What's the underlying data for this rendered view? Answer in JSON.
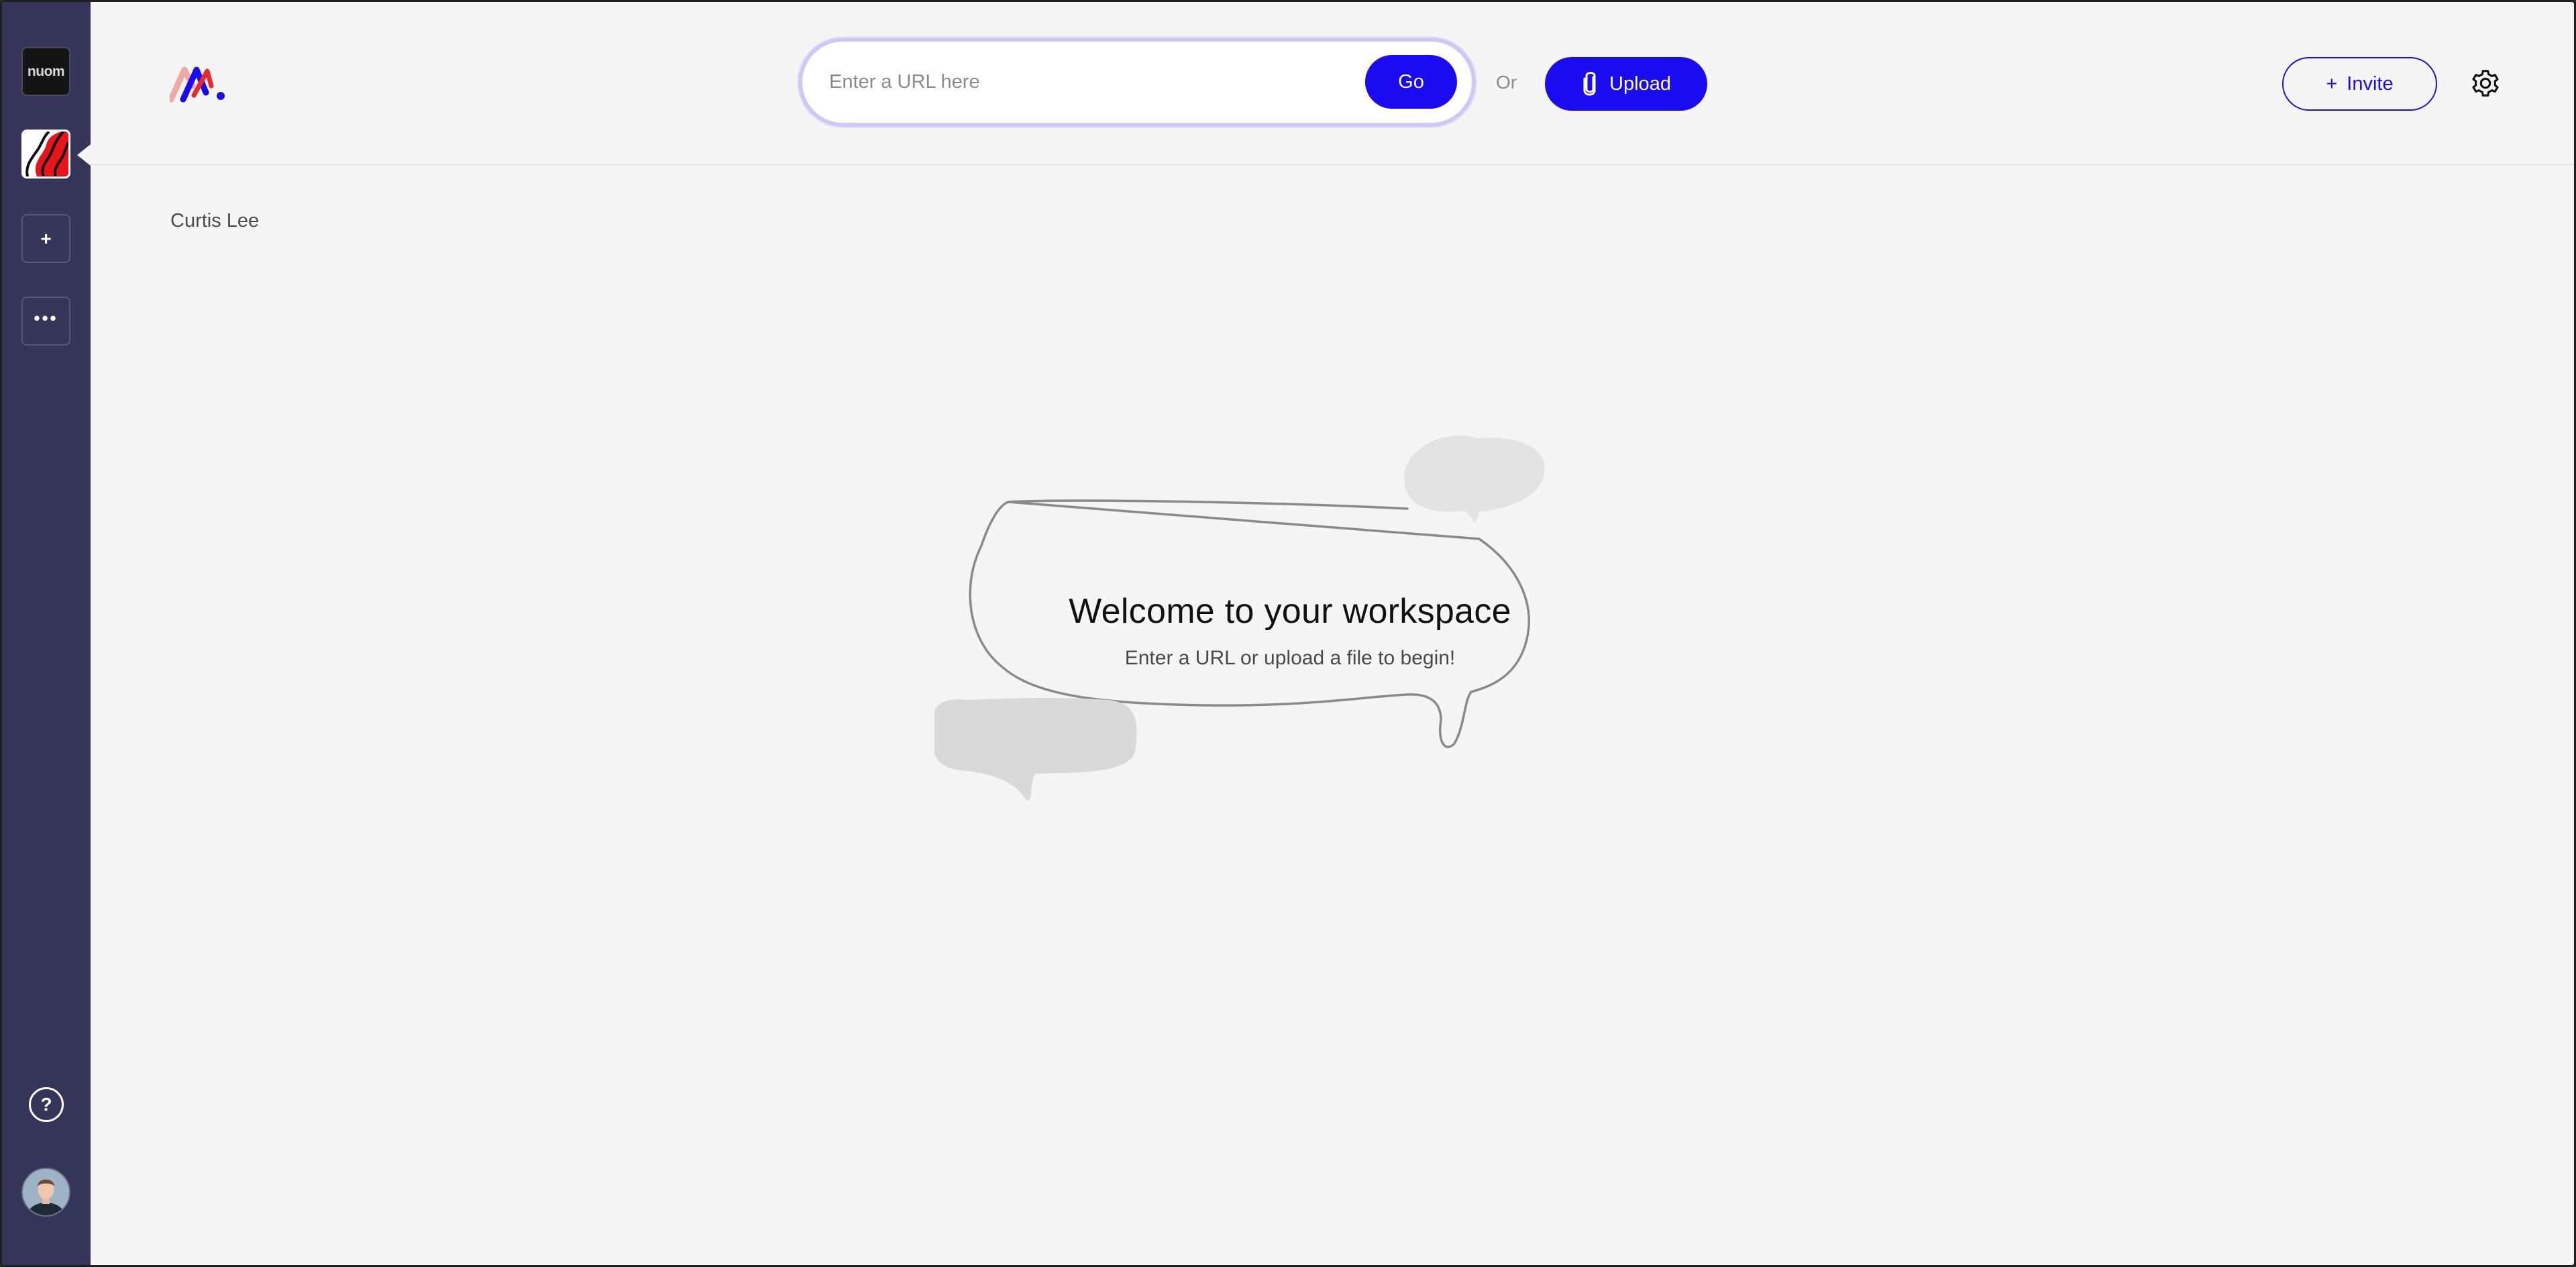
{
  "sidebar": {
    "workspaces": [
      {
        "label": "nuom",
        "active": false
      },
      {
        "label": "",
        "active": true
      }
    ],
    "add_label": "+",
    "more_label": "•••",
    "help_label": "?"
  },
  "header": {
    "url_placeholder": "Enter a URL here",
    "go_label": "Go",
    "or_label": "Or",
    "upload_label": "Upload",
    "invite_plus": "+",
    "invite_label": "Invite"
  },
  "main": {
    "user_name": "Curtis Lee",
    "welcome_title": "Welcome to your workspace",
    "welcome_subtitle": "Enter a URL or upload a file to begin!"
  },
  "colors": {
    "sidebar_bg": "#35355a",
    "accent": "#1a0bf0",
    "page_bg": "#f5f5f5",
    "input_ring": "#cfc8f5"
  },
  "icons": [
    "nuom-logo-icon",
    "workspace-thumbnail-icon",
    "plus-icon",
    "more-dots-icon",
    "help-icon",
    "paperclip-icon",
    "gear-icon",
    "app-logo-icon"
  ]
}
